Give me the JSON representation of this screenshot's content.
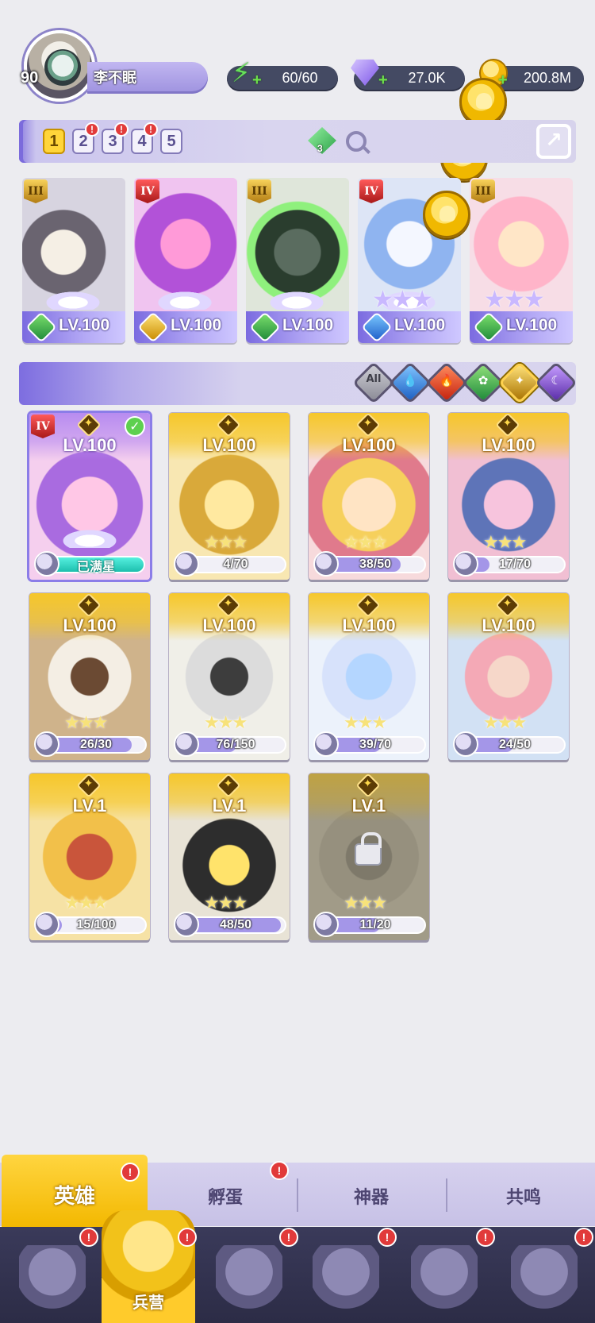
{
  "player": {
    "level": "90",
    "name": "李不眠"
  },
  "resources": {
    "energy": "60/60",
    "gems": "27.0K",
    "coins": "200.8M"
  },
  "team": {
    "tabs": [
      {
        "label": "1",
        "active": true,
        "alert": false
      },
      {
        "label": "2",
        "active": false,
        "alert": true
      },
      {
        "label": "3",
        "active": false,
        "alert": true
      },
      {
        "label": "4",
        "active": false,
        "alert": true
      },
      {
        "label": "5",
        "active": false,
        "alert": false
      }
    ],
    "gem_count": "3",
    "heroes": [
      {
        "rank": "III",
        "level": "LV.100",
        "element": "green"
      },
      {
        "rank": "IV",
        "level": "LV.100",
        "element": "gold"
      },
      {
        "rank": "III",
        "level": "LV.100",
        "element": "green"
      },
      {
        "rank": "IV",
        "level": "LV.100",
        "element": "blue"
      },
      {
        "rank": "III",
        "level": "LV.100",
        "element": "green"
      }
    ]
  },
  "filters": {
    "all_label": "All",
    "items": [
      "All",
      "water",
      "fire",
      "nature",
      "light",
      "dark"
    ],
    "active": "light"
  },
  "heroes": [
    {
      "level": "LV.100",
      "progress_text": "已满星",
      "maxed": true,
      "rank": "IV",
      "selected": true
    },
    {
      "level": "LV.100",
      "progress_text": "4/70",
      "current": 4,
      "max": 70
    },
    {
      "level": "LV.100",
      "progress_text": "38/50",
      "current": 38,
      "max": 50
    },
    {
      "level": "LV.100",
      "progress_text": "17/70",
      "current": 17,
      "max": 70
    },
    {
      "level": "LV.100",
      "progress_text": "26/30",
      "current": 26,
      "max": 30
    },
    {
      "level": "LV.100",
      "progress_text": "76/150",
      "current": 76,
      "max": 150
    },
    {
      "level": "LV.100",
      "progress_text": "39/70",
      "current": 39,
      "max": 70
    },
    {
      "level": "LV.100",
      "progress_text": "24/50",
      "current": 24,
      "max": 50
    },
    {
      "level": "LV.1",
      "progress_text": "15/100",
      "current": 15,
      "max": 100
    },
    {
      "level": "LV.1",
      "progress_text": "48/50",
      "current": 48,
      "max": 50
    },
    {
      "level": "LV.1",
      "progress_text": "11/20",
      "current": 11,
      "max": 20,
      "locked": true
    }
  ],
  "sub_tabs": {
    "hero": "英雄",
    "hatch": "孵蛋",
    "artifact": "神器",
    "resonance": "共鸣"
  },
  "nav": {
    "barracks": "兵营",
    "alert_mark": "!"
  },
  "colors": {
    "accent_gold": "#f3b800",
    "accent_purple": "#8b7de8",
    "nav_bg": "#2c2c46",
    "badge_red": "#e13a3a"
  }
}
